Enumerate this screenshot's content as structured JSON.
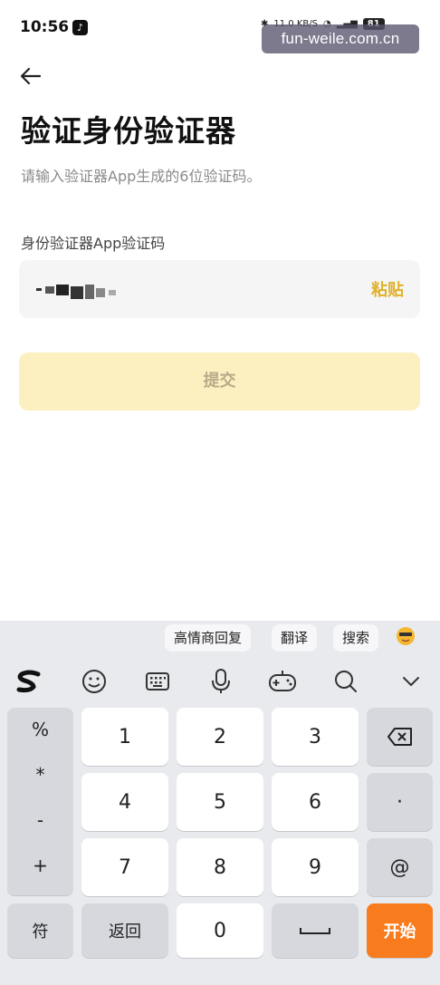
{
  "status_bar": {
    "time": "10:56",
    "app_icon": "tiktok-icon",
    "net_speed": "11.0 KB/S",
    "battery": "81"
  },
  "watermark": "fun-weile.com.cn",
  "page": {
    "title": "验证身份验证器",
    "subtitle": "请输入验证器App生成的6位验证码。",
    "field_label": "身份验证器App验证码",
    "paste_label": "粘贴",
    "submit_label": "提交"
  },
  "colors": {
    "accent": "#e0b12a",
    "submit_bg": "#fcefc0",
    "go_key": "#f87b1d"
  },
  "keyboard": {
    "suggestions": [
      "高情商回复",
      "翻译",
      "搜索"
    ],
    "toolbar_icons": [
      "sogou-logo-icon",
      "smile-icon",
      "keyboard-icon",
      "mic-icon",
      "gamepad-icon",
      "search-icon",
      "chevron-down-icon"
    ],
    "symbols": [
      "%",
      "*",
      "-",
      "+"
    ],
    "digits": [
      "1",
      "2",
      "3",
      "4",
      "5",
      "6",
      "7",
      "8",
      "9",
      "0"
    ],
    "dot": "·",
    "at": "@",
    "sym_key": "符",
    "back_key": "返回",
    "go_key": "开始"
  }
}
